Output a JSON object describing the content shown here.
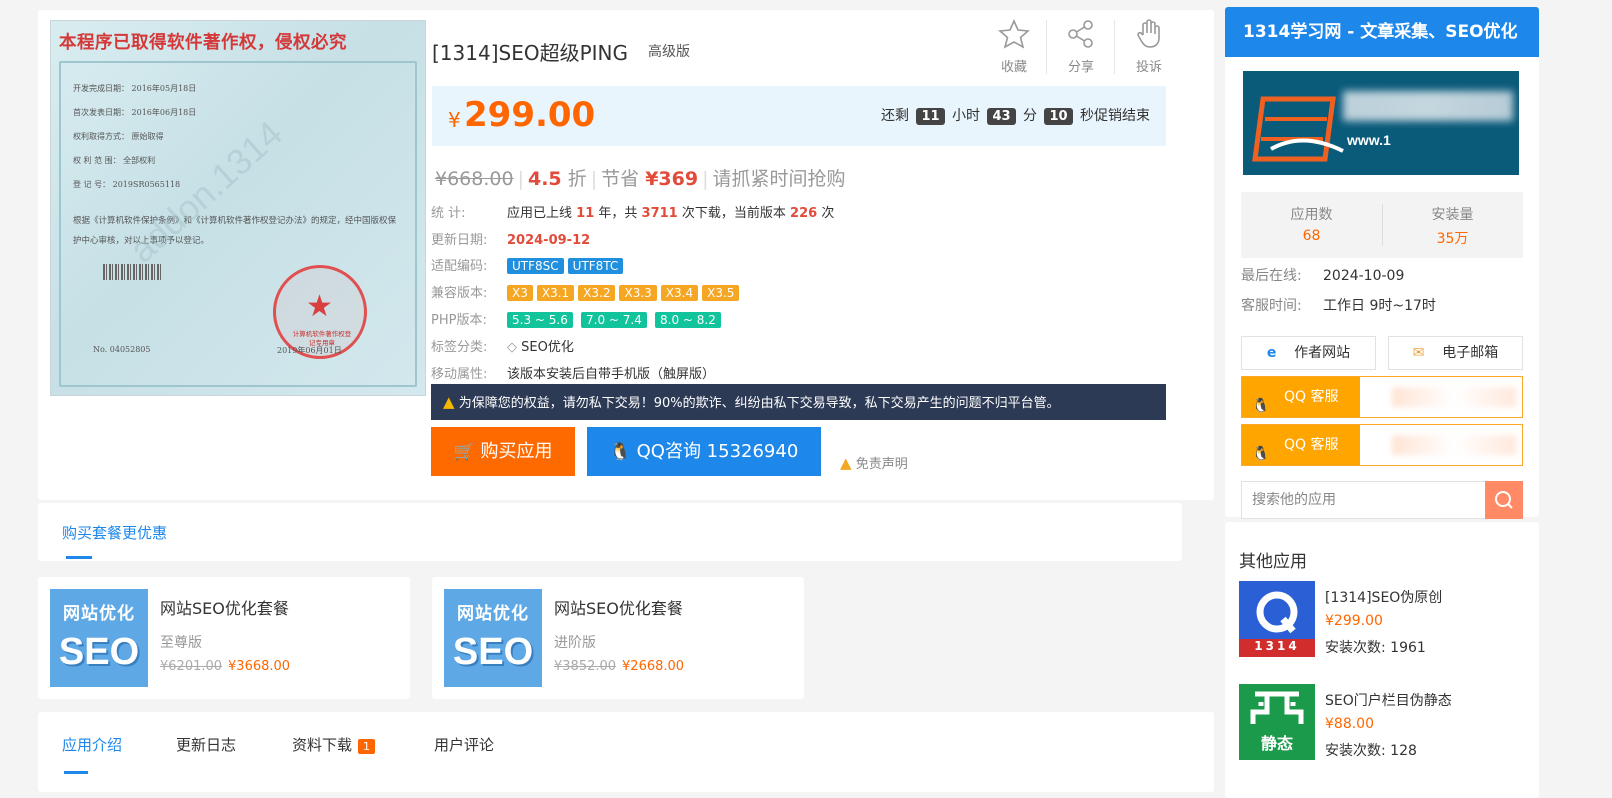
{
  "product": {
    "title": "[1314]SEO超级PING",
    "edition": "高级版",
    "actions": [
      {
        "label": "收藏",
        "icon": "star-icon"
      },
      {
        "label": "分享",
        "icon": "share-icon"
      },
      {
        "label": "投诉",
        "icon": "hand-icon"
      }
    ],
    "certificate": {
      "heading": "本程序已取得软件著作权，侵权必究",
      "rows": [
        "开发完成日期：   2016年05月18日",
        "首次发表日期：   2016年06月18日",
        "权利取得方式：   原始取得",
        "权  利  范  围：   全部权利",
        "登        记        号：   2019SR0565118"
      ],
      "text": "根据《计算机软件保护条例》和《计算机软件著作权登记办法》的规定，经中国版权保护中心审核，对以上事项予以登记。",
      "seal": "计算机软件著作权登记专用章",
      "number": "No. 04052805",
      "date": "2019年06月01日",
      "watermark": "addon.1314"
    },
    "price": {
      "currency": "¥",
      "current": "299.00",
      "countdown_prefix": "还剩",
      "hours": "11",
      "hours_unit": "小时",
      "minutes": "43",
      "minutes_unit": "分",
      "seconds": "10",
      "seconds_suffix": "秒促销结束",
      "original": "¥668.00",
      "discount": "4.5",
      "discount_unit": "折",
      "save_label": "节省",
      "save": "¥369",
      "hurry": "请抓紧时间抢购"
    },
    "info": {
      "stats_label": "统      计:",
      "stats_1": "应用已上线",
      "years": "11",
      "stats_2": "年，共",
      "downloads": "3711",
      "stats_3": "次下载，当前版本",
      "version_count": "226",
      "stats_4": "次",
      "update_label": "更新日期:",
      "update_date": "2024-09-12",
      "encoding_label": "适配编码:",
      "encodings": [
        "UTF8SC",
        "UTF8TC"
      ],
      "compat_label": "兼容版本:",
      "compat": [
        "X3",
        "X3.1",
        "X3.2",
        "X3.3",
        "X3.4",
        "X3.5"
      ],
      "php_label": "PHP版本:",
      "php": [
        "5.3 ~ 5.6",
        "7.0 ~ 7.4",
        "8.0 ~ 8.2"
      ],
      "tag_label": "标签分类:",
      "tag": "SEO优化",
      "mobile_label": "移动属性:",
      "mobile": "该版本安装后自带手机版（触屏版）"
    },
    "warning": "为保障您的权益，请勿私下交易！90%的欺诈、纠纷由私下交易导致，私下交易产生的问题不归平台管。",
    "buy_label": "购买应用",
    "qq_label": "QQ咨询 15326940",
    "disclaimer": "免责声明"
  },
  "packages": {
    "tab": "购买套餐更优惠",
    "image_text_top": "网站优化",
    "image_text_bottom": "SEO",
    "items": [
      {
        "name": "网站SEO优化套餐",
        "level": "至尊版",
        "original": "¥6201.00",
        "price": "¥3668.00"
      },
      {
        "name": "网站SEO优化套餐",
        "level": "进阶版",
        "original": "¥3852.00",
        "price": "¥2668.00"
      }
    ]
  },
  "bottom_tabs": [
    {
      "label": "应用介绍"
    },
    {
      "label": "更新日志"
    },
    {
      "label": "资料下载",
      "badge": "1"
    },
    {
      "label": "用户评论"
    }
  ],
  "sidebar": {
    "title": "1314学习网 - 文章采集、SEO优化",
    "banner_url": "www.1",
    "app_count_label": "应用数",
    "app_count": "68",
    "install_label": "安装量",
    "install": "35万",
    "last_online_label": "最后在线:",
    "last_online": "2024-10-09",
    "service_label": "客服时间:",
    "service": "工作日 9时~17时",
    "website_button": "作者网站",
    "email_button": "电子邮箱",
    "qq_service": "QQ 客服",
    "search_placeholder": "搜索他的应用"
  },
  "others": {
    "heading": "其他应用",
    "items": [
      {
        "name": "[1314]SEO伪原创",
        "price": "¥299.00",
        "installs": "安装次数: 1961",
        "icon_text": "1314"
      },
      {
        "name": "SEO门户栏目伪静态",
        "price": "¥88.00",
        "installs": "安装次数: 128",
        "icon_text": "静态"
      }
    ]
  },
  "colors": {
    "accent": "#1e88ea",
    "orange": "#ff6600",
    "red": "#e24a3a",
    "warning_bg": "#2d3a56"
  }
}
